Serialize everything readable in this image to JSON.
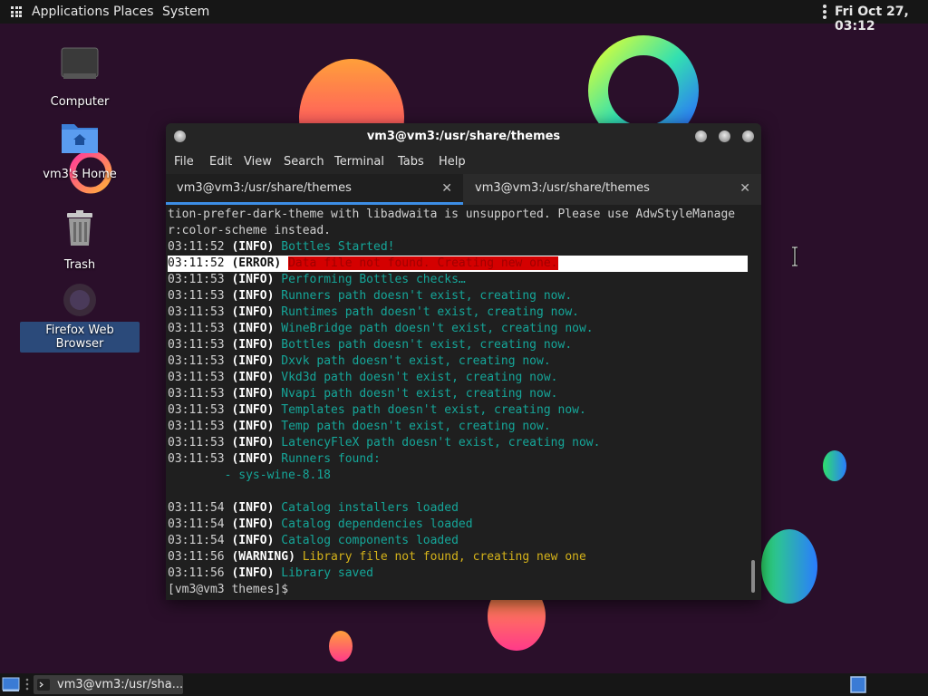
{
  "top_panel": {
    "menus": [
      "Applications",
      "Places",
      "System"
    ],
    "clock": "Fri Oct 27, 03:12"
  },
  "desktop_icons": [
    {
      "label": "Computer",
      "icon": "computer-icon"
    },
    {
      "label": "vm3's Home",
      "icon": "home-folder-icon"
    },
    {
      "label": "Trash",
      "icon": "trash-icon"
    },
    {
      "label": "Firefox Web Browser",
      "icon": "firefox-icon"
    }
  ],
  "terminal": {
    "title": "vm3@vm3:/usr/share/themes",
    "menu": [
      "File",
      "Edit",
      "View",
      "Search",
      "Terminal",
      "Tabs",
      "Help"
    ],
    "tabs": [
      {
        "label": "vm3@vm3:/usr/share/themes",
        "active": true
      },
      {
        "label": "vm3@vm3:/usr/share/themes",
        "active": false
      }
    ],
    "lines": [
      {
        "type": "plain",
        "text": "tion-prefer-dark-theme with libadwaita is unsupported. Please use AdwStyleManage"
      },
      {
        "type": "plain",
        "text": "r:color-scheme instead."
      },
      {
        "type": "log",
        "ts": "03:11:52",
        "level": "(INFO)",
        "msg": "Bottles Started!"
      },
      {
        "type": "error",
        "ts": "03:11:52",
        "level": "(ERROR)",
        "msg": "Data file not found. Creating new one."
      },
      {
        "type": "log",
        "ts": "03:11:53",
        "level": "(INFO)",
        "msg": "Performing Bottles checks…"
      },
      {
        "type": "log",
        "ts": "03:11:53",
        "level": "(INFO)",
        "msg": "Runners path doesn't exist, creating now."
      },
      {
        "type": "log",
        "ts": "03:11:53",
        "level": "(INFO)",
        "msg": "Runtimes path doesn't exist, creating now."
      },
      {
        "type": "log",
        "ts": "03:11:53",
        "level": "(INFO)",
        "msg": "WineBridge path doesn't exist, creating now."
      },
      {
        "type": "log",
        "ts": "03:11:53",
        "level": "(INFO)",
        "msg": "Bottles path doesn't exist, creating now."
      },
      {
        "type": "log",
        "ts": "03:11:53",
        "level": "(INFO)",
        "msg": "Dxvk path doesn't exist, creating now."
      },
      {
        "type": "log",
        "ts": "03:11:53",
        "level": "(INFO)",
        "msg": "Vkd3d path doesn't exist, creating now."
      },
      {
        "type": "log",
        "ts": "03:11:53",
        "level": "(INFO)",
        "msg": "Nvapi path doesn't exist, creating now."
      },
      {
        "type": "log",
        "ts": "03:11:53",
        "level": "(INFO)",
        "msg": "Templates path doesn't exist, creating now."
      },
      {
        "type": "log",
        "ts": "03:11:53",
        "level": "(INFO)",
        "msg": "Temp path doesn't exist, creating now."
      },
      {
        "type": "log",
        "ts": "03:11:53",
        "level": "(INFO)",
        "msg": "LatencyFleX path doesn't exist, creating now."
      },
      {
        "type": "log",
        "ts": "03:11:53",
        "level": "(INFO)",
        "msg": "Runners found:"
      },
      {
        "type": "indent",
        "text": "        - sys-wine-8.18"
      },
      {
        "type": "blank",
        "text": ""
      },
      {
        "type": "log",
        "ts": "03:11:54",
        "level": "(INFO)",
        "msg": "Catalog installers loaded"
      },
      {
        "type": "log",
        "ts": "03:11:54",
        "level": "(INFO)",
        "msg": "Catalog dependencies loaded"
      },
      {
        "type": "log",
        "ts": "03:11:54",
        "level": "(INFO)",
        "msg": "Catalog components loaded"
      },
      {
        "type": "warn",
        "ts": "03:11:56",
        "level": "(WARNING)",
        "msg": "Library file not found, creating new one"
      },
      {
        "type": "log",
        "ts": "03:11:56",
        "level": "(INFO)",
        "msg": "Library saved"
      },
      {
        "type": "prompt",
        "text": "[vm3@vm3 themes]$"
      }
    ]
  },
  "bottom_panel": {
    "task_label": "vm3@vm3:/usr/sha..."
  },
  "colors": {
    "info": "#15a699",
    "warning": "#d4b21a",
    "error_bg": "#d40000",
    "accent": "#3d8ee6"
  }
}
